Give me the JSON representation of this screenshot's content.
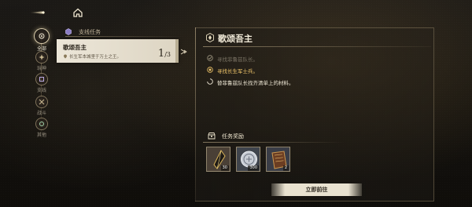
{
  "left_rail": {
    "items": [
      {
        "label": "全部",
        "active": true,
        "icon": "all-quests-icon"
      },
      {
        "label": "玩神",
        "active": false,
        "icon": "main-quest-icon"
      },
      {
        "label": "支线",
        "active": false,
        "icon": "side-quest-icon"
      },
      {
        "label": "战斗",
        "active": false,
        "icon": "combat-icon"
      },
      {
        "label": "其他",
        "active": false,
        "icon": "misc-icon"
      }
    ]
  },
  "quest_list": {
    "category": "支线任务",
    "selected_quest": {
      "title": "歌颂吾主",
      "subtitle": "长生军本城坚于万土之王。",
      "progress_current": "1",
      "progress_total": "3"
    }
  },
  "detail": {
    "title": "歌颂吾主",
    "objectives": [
      {
        "text": "寻找菲鲁兹队长。",
        "state": "done"
      },
      {
        "text": "寻找长生军士兵。",
        "state": "current"
      },
      {
        "text": "替菲鲁兹队长找齐清单上的材料。",
        "state": "pending"
      }
    ],
    "rewards_label": "任务奖励",
    "rewards": [
      {
        "icon": "crystal-shard-icon",
        "qty": "30"
      },
      {
        "icon": "silver-coin-icon",
        "qty": "300"
      },
      {
        "icon": "book-icon",
        "qty": "2"
      }
    ],
    "go_button_label": "立即前往"
  },
  "colors": {
    "accent_gold": "#f0c66a",
    "card_bg": "#ece6d8",
    "text_light": "#efe8d6"
  }
}
